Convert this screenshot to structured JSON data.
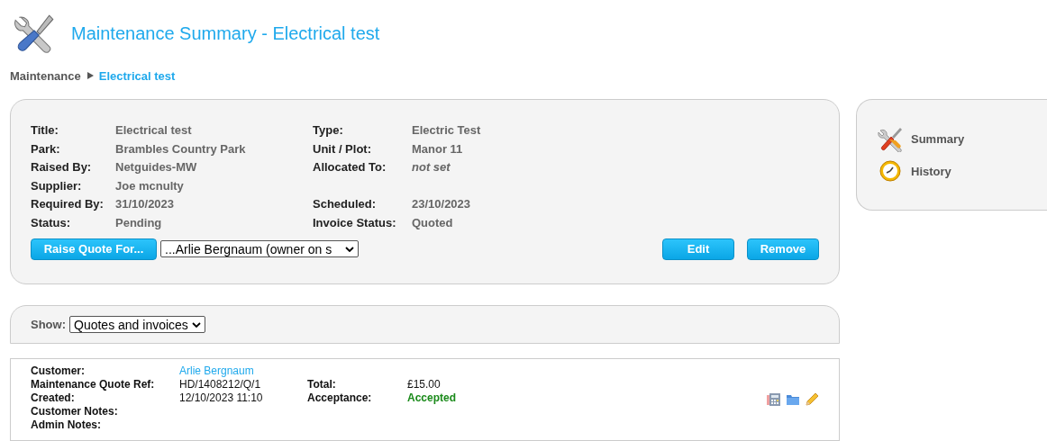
{
  "header": {
    "title": "Maintenance Summary - Electrical test"
  },
  "breadcrumb": [
    {
      "label": "Maintenance",
      "current": false
    },
    {
      "label": "Electrical test",
      "current": true
    }
  ],
  "details": {
    "rows": [
      {
        "left": {
          "label": "Title:",
          "value": "Electrical test",
          "kind": "plain"
        },
        "right": {
          "label": "Type:",
          "value": "Electric Test",
          "kind": "plain"
        }
      },
      {
        "left": {
          "label": "Park:",
          "value": "Brambles Country Park",
          "kind": "plain"
        },
        "right": {
          "label": "Unit / Plot:",
          "value": "Manor 11",
          "kind": "plain"
        }
      },
      {
        "left": {
          "label": "Raised By:",
          "value": "Netguides-MW",
          "kind": "plain"
        },
        "right": {
          "label": "Allocated To:",
          "value": "not set",
          "kind": "unset"
        }
      },
      {
        "left": {
          "label": "Supplier:",
          "value": "Joe mcnulty",
          "kind": "plain"
        }
      },
      {
        "left": {
          "label": "Required By:",
          "value": "31/10/2023",
          "kind": "plain"
        },
        "right": {
          "label": "Scheduled:",
          "value": "23/10/2023",
          "kind": "plain"
        }
      },
      {
        "left": {
          "label": "Status:",
          "value": "Pending",
          "kind": "plain"
        },
        "right": {
          "label": "Invoice Status:",
          "value": "Quoted",
          "kind": "plain"
        }
      }
    ],
    "raise_button": "Raise Quote For...",
    "recipient_select": "...Arlie Bergnaum (owner on s",
    "buttons": [
      "Edit",
      "Remove"
    ]
  },
  "sidebar": {
    "items": [
      {
        "label": "Summary",
        "kind": "tools"
      },
      {
        "label": "History",
        "kind": "clock"
      }
    ]
  },
  "filter": {
    "label": "Show:",
    "value": "Quotes and invoices"
  },
  "quote": {
    "rows": [
      {
        "left": {
          "label": "Customer:",
          "value": "Arlie Bergnaum",
          "kind": "link"
        }
      },
      {
        "left": {
          "label": "Maintenance Quote Ref:",
          "value": "HD/1408212/Q/1",
          "kind": "plain"
        },
        "right": {
          "label": "Total:",
          "value": "£15.00",
          "kind": "plain"
        }
      },
      {
        "left": {
          "label": "Created:",
          "value": "12/10/2023 11:10",
          "kind": "plain"
        },
        "right": {
          "label": "Acceptance:",
          "value": "Accepted",
          "kind": "status"
        }
      },
      {
        "left": {
          "label": "Customer Notes:"
        }
      },
      {
        "left": {
          "label": "Admin Notes:"
        }
      }
    ]
  }
}
